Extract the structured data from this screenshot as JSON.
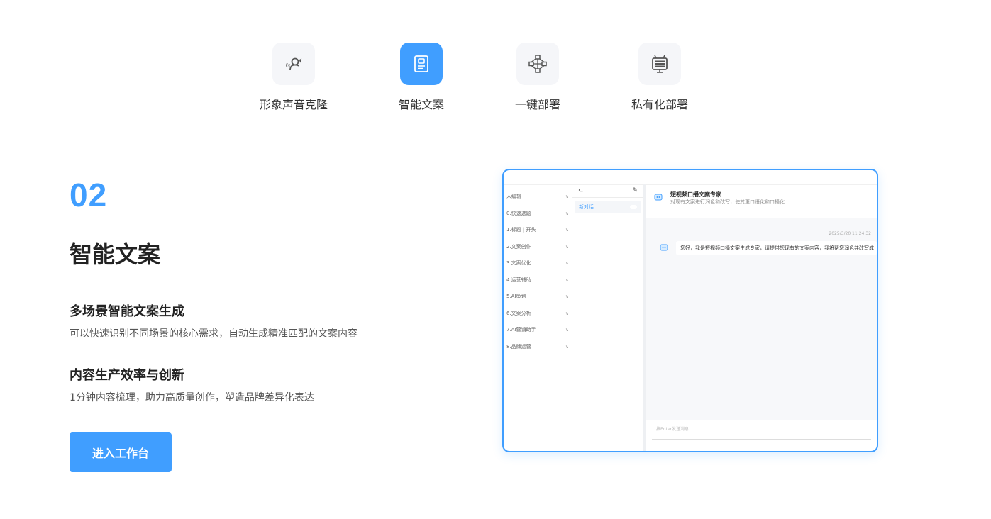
{
  "features": [
    {
      "label": "形象声音克隆",
      "icon": "voice-clone-icon",
      "active": false
    },
    {
      "label": "智能文案",
      "icon": "document-icon",
      "active": true
    },
    {
      "label": "一键部署",
      "icon": "network-icon",
      "active": false
    },
    {
      "label": "私有化部署",
      "icon": "server-icon",
      "active": false
    }
  ],
  "section": {
    "number": "02",
    "title": "智能文案",
    "points": [
      {
        "heading": "多场景智能文案生成",
        "text": "可以快速识别不同场景的核心需求，自动生成精准匹配的文案内容"
      },
      {
        "heading": "内容生产效率与创新",
        "text": "1分钟内容梳理，助力高质量创作，塑造品牌差异化表达"
      }
    ],
    "cta": "进入工作台"
  },
  "preview": {
    "sidebar": [
      "人编辑",
      "0.快速选题",
      "1.标题 | 开头",
      "2.文案创作",
      "3.文案优化",
      "4.运营辅助",
      "5.AI策划",
      "6.文案分析",
      "7.AI营销助手",
      "8.品牌运营"
    ],
    "toolbar_back": "⊂",
    "toolbar_edit": "✎",
    "conversation": "新对话",
    "conversation_badge": "···",
    "bot_name": "短视频口播文案专家",
    "bot_desc": "对现有文案进行润色和改写，使其更口语化和口播化",
    "timestamp": "2025/3/20 11:24:32",
    "bot_message": "您好，我是短视频口播文案生成专家，请提供您现有的文案内容，我将帮您润色并改写成",
    "input_placeholder": "按Enter发送消息"
  },
  "colors": {
    "accent": "#409eff",
    "icon_bg": "#f5f6f9"
  }
}
